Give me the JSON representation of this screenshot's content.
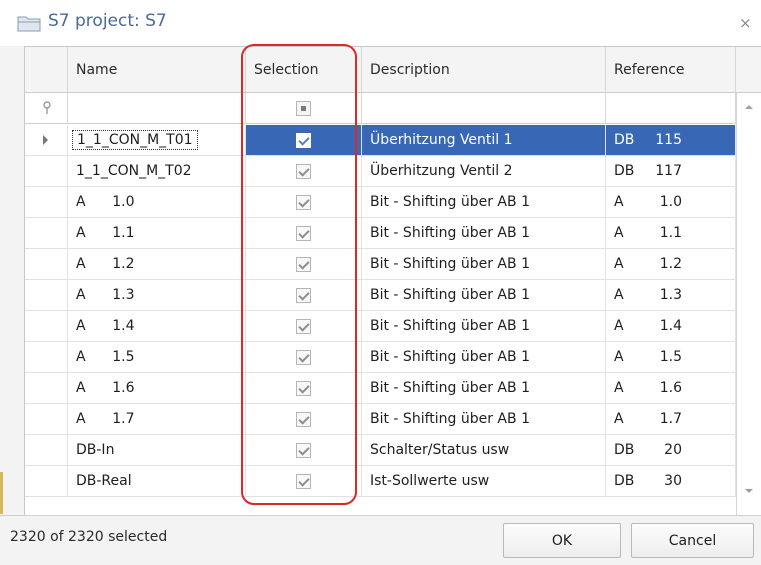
{
  "window": {
    "title": "S7 project: S7",
    "close_glyph": "×",
    "icon": "folder-icon"
  },
  "grid": {
    "columns": [
      {
        "key": "name",
        "label": "Name"
      },
      {
        "key": "selection",
        "label": "Selection"
      },
      {
        "key": "description",
        "label": "Description"
      },
      {
        "key": "reference",
        "label": "Reference"
      }
    ],
    "filter_pin_icon": "pin-icon",
    "selection_header_state": "indeterminate",
    "rows": [
      {
        "name": "1_1_CON_M_T01",
        "selected": true,
        "description": "Überhitzung Ventil 1",
        "ref_type": "DB",
        "ref_num": "115",
        "current": true
      },
      {
        "name": "1_1_CON_M_T02",
        "selected": true,
        "description": "Überhitzung Ventil 2",
        "ref_type": "DB",
        "ref_num": "117",
        "current": false
      },
      {
        "name": "A      1.0",
        "selected": true,
        "description": "Bit - Shifting über AB 1",
        "ref_type": "A",
        "ref_num": "1.0",
        "current": false
      },
      {
        "name": "A      1.1",
        "selected": true,
        "description": "Bit - Shifting über AB 1",
        "ref_type": "A",
        "ref_num": "1.1",
        "current": false
      },
      {
        "name": "A      1.2",
        "selected": true,
        "description": "Bit - Shifting über AB 1",
        "ref_type": "A",
        "ref_num": "1.2",
        "current": false
      },
      {
        "name": "A      1.3",
        "selected": true,
        "description": "Bit - Shifting über AB 1",
        "ref_type": "A",
        "ref_num": "1.3",
        "current": false
      },
      {
        "name": "A      1.4",
        "selected": true,
        "description": "Bit - Shifting über AB 1",
        "ref_type": "A",
        "ref_num": "1.4",
        "current": false
      },
      {
        "name": "A      1.5",
        "selected": true,
        "description": "Bit - Shifting über AB 1",
        "ref_type": "A",
        "ref_num": "1.5",
        "current": false
      },
      {
        "name": "A      1.6",
        "selected": true,
        "description": "Bit - Shifting über AB 1",
        "ref_type": "A",
        "ref_num": "1.6",
        "current": false
      },
      {
        "name": "A      1.7",
        "selected": true,
        "description": "Bit - Shifting über AB 1",
        "ref_type": "A",
        "ref_num": "1.7",
        "current": false
      },
      {
        "name": "DB-In",
        "selected": true,
        "description": "Schalter/Status usw",
        "ref_type": "DB",
        "ref_num": "20",
        "current": false
      },
      {
        "name": "DB-Real",
        "selected": true,
        "description": "Ist-Sollwerte usw",
        "ref_type": "DB",
        "ref_num": "30",
        "current": false
      }
    ]
  },
  "footer": {
    "status": "2320 of 2320 selected",
    "ok_label": "OK",
    "cancel_label": "Cancel"
  },
  "colors": {
    "selection_blue": "#3767b5",
    "highlight_red": "#d92a2a",
    "title_blue": "#4a6a96"
  }
}
